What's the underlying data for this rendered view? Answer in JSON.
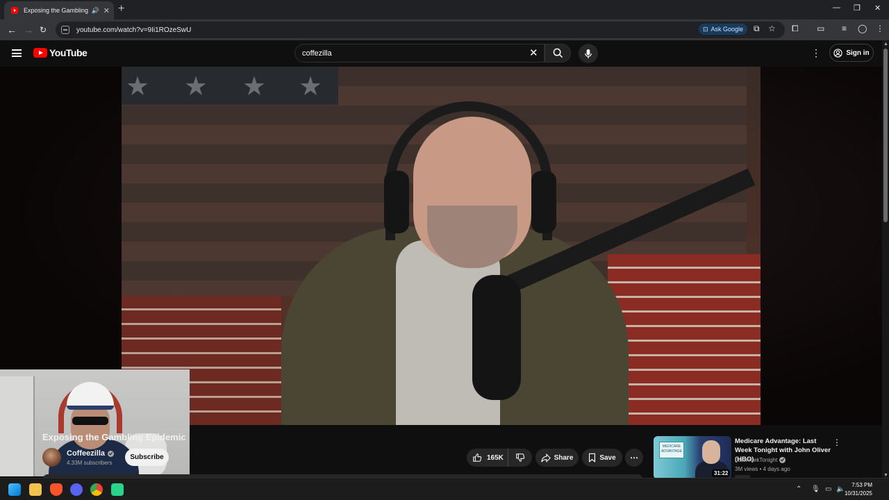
{
  "browser": {
    "tab_title": "Exposing the Gambling Epidemic",
    "url": "youtube.com/watch?v=9Ii1ROzeSwU",
    "ask_google_label": "Ask Google"
  },
  "youtube": {
    "logo_text": "YouTube",
    "search_value": "coffezilla",
    "sign_in_label": "Sign in"
  },
  "video": {
    "title": "Exposing the Gambling Epidemic",
    "channel_name": "Coffeezilla",
    "subscribers": "4.33M subscribers",
    "subscribe_label": "Subscribe",
    "like_count": "165K",
    "share_label": "Share",
    "save_label": "Save"
  },
  "recommendation": {
    "title": "Medicare Advantage: Last Week Tonight with John Oliver (HBO)",
    "channel": "LastWeekTonight",
    "meta": "3M views • 4 days ago",
    "duration": "31:22",
    "thumb_text": "MEDICARE ADVANTAGE"
  },
  "taskbar": {
    "time": "7:53 PM",
    "date": "10/31/2025"
  },
  "colors": {
    "youtube_red": "#ff0000",
    "background": "#0f0f0f",
    "chrome_dark": "#202124"
  }
}
